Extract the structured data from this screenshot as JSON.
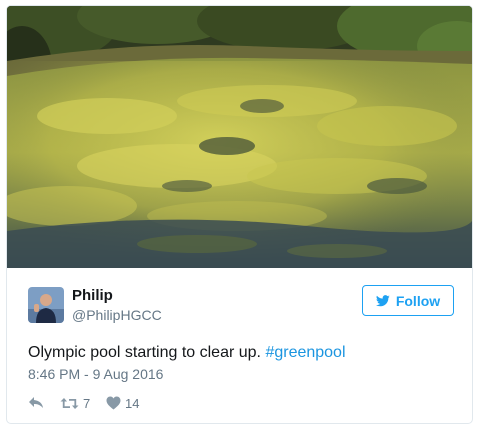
{
  "tweet": {
    "display_name": "Philip",
    "handle": "@PhilipHGCC",
    "text_prefix": "Olympic pool starting to clear up. ",
    "hashtag": "#greenpool",
    "timestamp": "8:46 PM - 9 Aug 2016",
    "retweet_count": "7",
    "like_count": "14"
  },
  "follow_button": {
    "label": "Follow"
  },
  "icons": {
    "follow": "twitter-bird-icon",
    "reply": "reply-icon",
    "retweet": "retweet-icon",
    "like": "heart-icon"
  },
  "colors": {
    "accent": "#1da1f2",
    "hashtag": "#1b95e0",
    "muted": "#657786",
    "text": "#14171a"
  }
}
